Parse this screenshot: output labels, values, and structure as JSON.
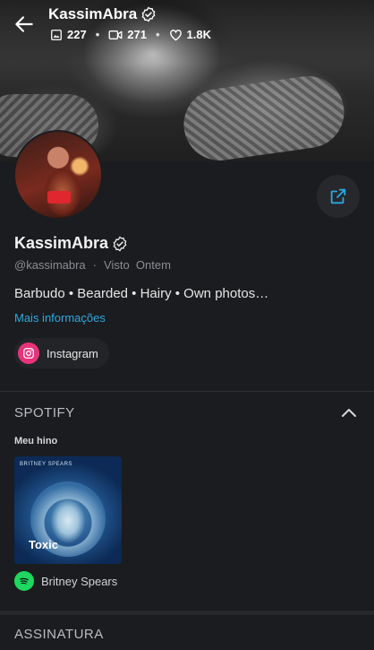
{
  "header": {
    "title": "KassimAbra",
    "stats": {
      "photos": "227",
      "videos": "271",
      "likes": "1.8K"
    }
  },
  "profile": {
    "name": "KassimAbra",
    "handle": "@kassimabra",
    "last_seen": "Visto  Ontem",
    "bio": "Barbudo • Bearded • Hairy • Own photos…",
    "more_link": "Mais informações",
    "social": "Instagram"
  },
  "spotify": {
    "section_title": "SPOTIFY",
    "anthem_label": "Meu hino",
    "track": "Toxic",
    "album_caption": "BRITNEY SPEARS",
    "artist": "Britney Spears"
  },
  "next_section": {
    "title": "ASSINATURA"
  },
  "colors": {
    "accent": "#2aa9e0",
    "instagram": "#e8337a",
    "spotify": "#1ed760",
    "background": "#1b1c1f"
  },
  "icons": [
    "back-arrow-icon",
    "verified-icon",
    "image-icon",
    "video-icon",
    "heart-icon",
    "share-icon",
    "instagram-icon",
    "chevron-up-icon",
    "spotify-icon"
  ]
}
